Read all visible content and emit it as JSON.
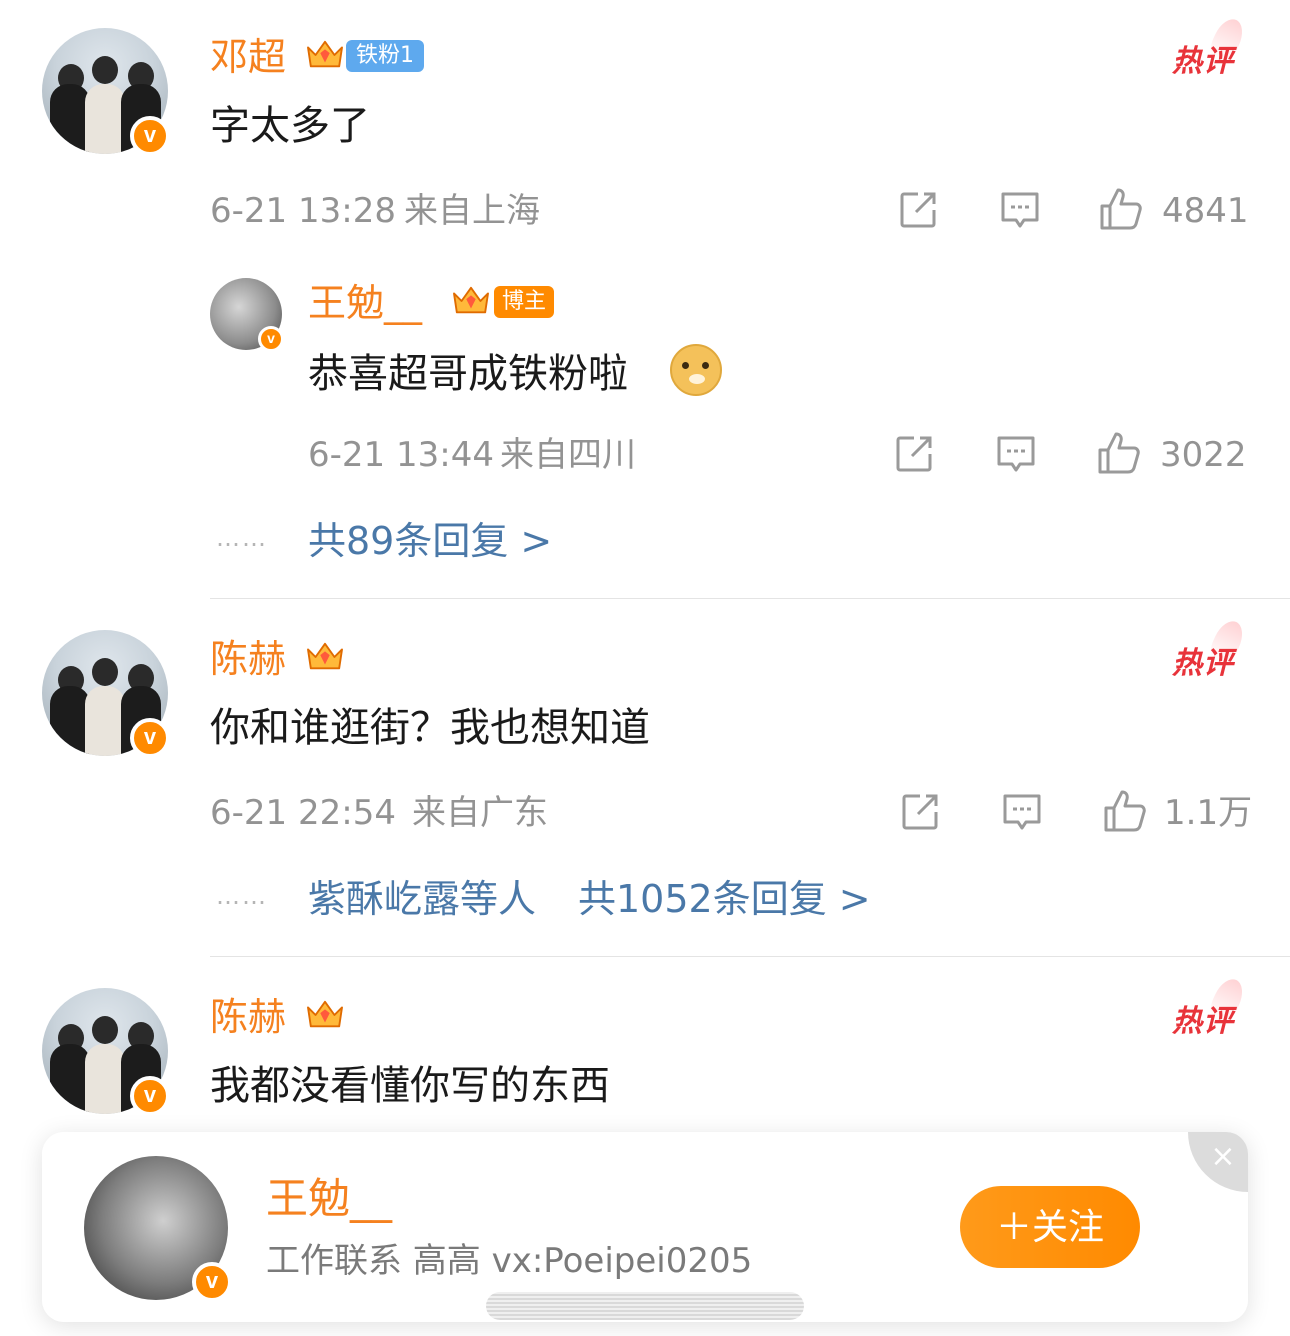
{
  "comments": [
    {
      "username": "邓超",
      "tag": "铁粉1",
      "hot_label": "热评",
      "text": "字太多了",
      "time": "6-21 13:28",
      "location": "来自上海",
      "likes": "4841",
      "reply": {
        "username": "王勉__",
        "tag": "博主",
        "text": "恭喜超哥成铁粉啦",
        "emoji": "doge-emoji",
        "time": "6-21 13:44",
        "location": "来自四川",
        "likes": "3022"
      },
      "dots": "……",
      "replies_prefix": "",
      "replies_link": "共89条回复 >"
    },
    {
      "username": "陈赫",
      "hot_label": "热评",
      "text": "你和谁逛街？我也想知道",
      "time": "6-21 22:54",
      "location": "来自广东",
      "likes": "1.1万",
      "dots": "……",
      "replies_prefix": "紫酥屹露等人",
      "replies_link": "共1052条回复 >"
    },
    {
      "username": "陈赫",
      "hot_label": "热评",
      "text": "我都没看懂你写的东西"
    }
  ],
  "popup": {
    "name": "王勉__",
    "desc": "工作联系 高高 vx:Poeipei0205",
    "follow_label": "＋关注",
    "close_label": "×"
  },
  "colors": {
    "username": "#f5811f",
    "link": "#4a78a8",
    "meta": "#939393",
    "hot": "#e8333a",
    "follow": "#ff8a00",
    "fan_tag": "#5ea9ee"
  },
  "icons": [
    "share-icon",
    "comment-icon",
    "like-icon",
    "verified-icon",
    "crown-icon",
    "close-icon"
  ]
}
